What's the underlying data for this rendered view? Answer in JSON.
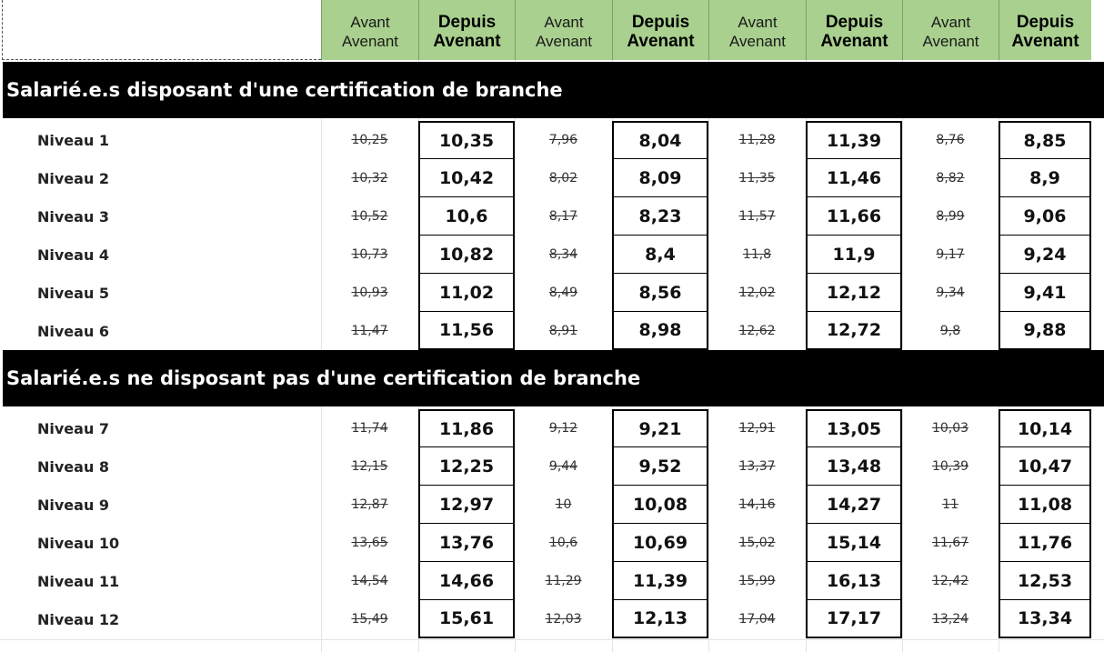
{
  "header": {
    "columns": [
      {
        "line1": "Avant",
        "line2": "Avenant"
      },
      {
        "line1": "Depuis",
        "line2": "Avenant"
      },
      {
        "line1": "Avant",
        "line2": "Avenant"
      },
      {
        "line1": "Depuis",
        "line2": "Avenant"
      },
      {
        "line1": "Avant",
        "line2": "Avenant"
      },
      {
        "line1": "Depuis",
        "line2": "Avenant"
      },
      {
        "line1": "Avant",
        "line2": "Avenant"
      },
      {
        "line1": "Depuis",
        "line2": "Avenant"
      }
    ]
  },
  "sections": [
    {
      "title": "Salarié.e.s disposant d'une certification de branche",
      "rows": [
        {
          "label": "Niveau 1",
          "values": [
            "10,25",
            "10,35",
            "7,96",
            "8,04",
            "11,28",
            "11,39",
            "8,76",
            "8,85"
          ]
        },
        {
          "label": "Niveau 2",
          "values": [
            "10,32",
            "10,42",
            "8,02",
            "8,09",
            "11,35",
            "11,46",
            "8,82",
            "8,9"
          ]
        },
        {
          "label": "Niveau 3",
          "values": [
            "10,52",
            "10,6",
            "8,17",
            "8,23",
            "11,57",
            "11,66",
            "8,99",
            "9,06"
          ]
        },
        {
          "label": "Niveau 4",
          "values": [
            "10,73",
            "10,82",
            "8,34",
            "8,4",
            "11,8",
            "11,9",
            "9,17",
            "9,24"
          ]
        },
        {
          "label": "Niveau 5",
          "values": [
            "10,93",
            "11,02",
            "8,49",
            "8,56",
            "12,02",
            "12,12",
            "9,34",
            "9,41"
          ]
        },
        {
          "label": "Niveau 6",
          "values": [
            "11,47",
            "11,56",
            "8,91",
            "8,98",
            "12,62",
            "12,72",
            "9,8",
            "9,88"
          ]
        }
      ]
    },
    {
      "title": "Salarié.e.s ne disposant pas d'une certification de branche",
      "rows": [
        {
          "label": "Niveau 7",
          "values": [
            "11,74",
            "11,86",
            "9,12",
            "9,21",
            "12,91",
            "13,05",
            "10,03",
            "10,14"
          ]
        },
        {
          "label": "Niveau 8",
          "values": [
            "12,15",
            "12,25",
            "9,44",
            "9,52",
            "13,37",
            "13,48",
            "10,39",
            "10,47"
          ]
        },
        {
          "label": "Niveau 9",
          "values": [
            "12,87",
            "12,97",
            "10",
            "10,08",
            "14,16",
            "14,27",
            "11",
            "11,08"
          ]
        },
        {
          "label": "Niveau 10",
          "values": [
            "13,65",
            "13,76",
            "10,6",
            "10,69",
            "15,02",
            "15,14",
            "11,67",
            "11,76"
          ]
        },
        {
          "label": "Niveau 11",
          "values": [
            "14,54",
            "14,66",
            "11,29",
            "11,39",
            "15,99",
            "16,13",
            "12,42",
            "12,53"
          ]
        },
        {
          "label": "Niveau 12",
          "values": [
            "15,49",
            "15,61",
            "12,03",
            "12,13",
            "17,04",
            "17,17",
            "13,24",
            "13,34"
          ]
        }
      ]
    }
  ]
}
